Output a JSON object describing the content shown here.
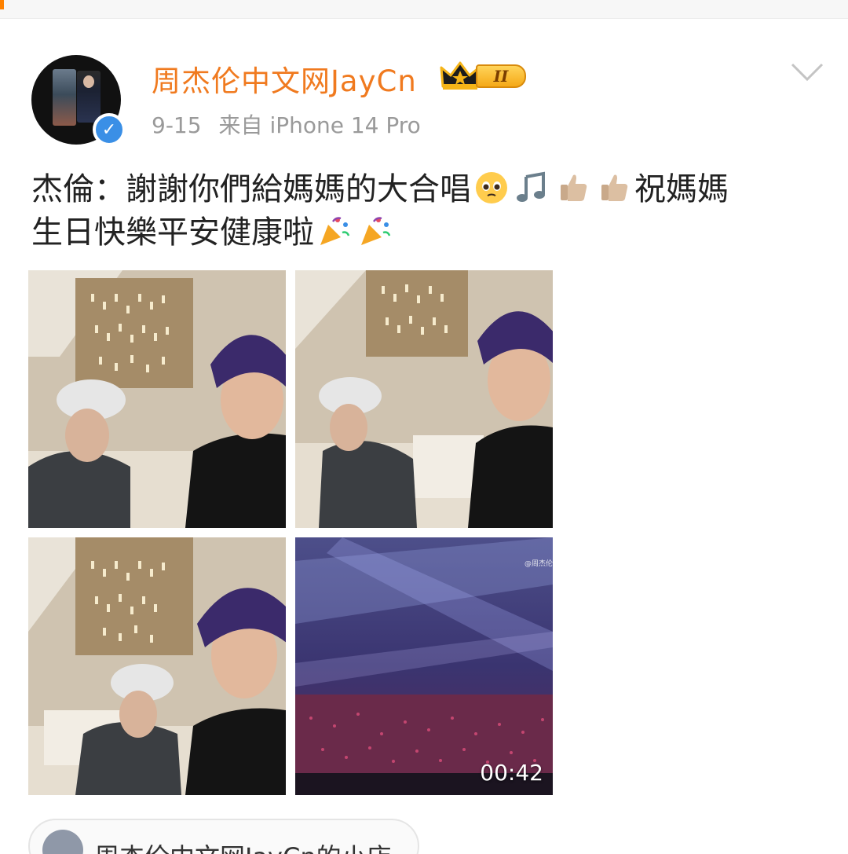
{
  "post": {
    "author": "周杰伦中文网JayCn",
    "level_badge": "II",
    "date": "9-15",
    "source": "来自 iPhone 14 Pro",
    "text_line1": "杰倫：謝謝你們給媽媽的大合唱",
    "text_line1_tail": "祝媽媽",
    "text_line2": "生日快樂平安健康啦",
    "emojis_line1": [
      "pleading-face-emoji",
      "music-note-emoji",
      "thumbs-up-emoji",
      "thumbs-up-emoji"
    ],
    "emojis_line2": [
      "party-popper-emoji",
      "party-popper-emoji"
    ]
  },
  "media": {
    "images": [
      "photo-selfie-1",
      "photo-selfie-2",
      "photo-selfie-3",
      "video-concert"
    ],
    "video_duration": "00:42",
    "video_watermark": "@周杰伦中"
  },
  "shop": {
    "label": "周杰伦中文网JayCn的小店"
  },
  "colors": {
    "username": "#f07a1f",
    "verified": "#3a8fe6",
    "meta": "#9a9a9a"
  }
}
